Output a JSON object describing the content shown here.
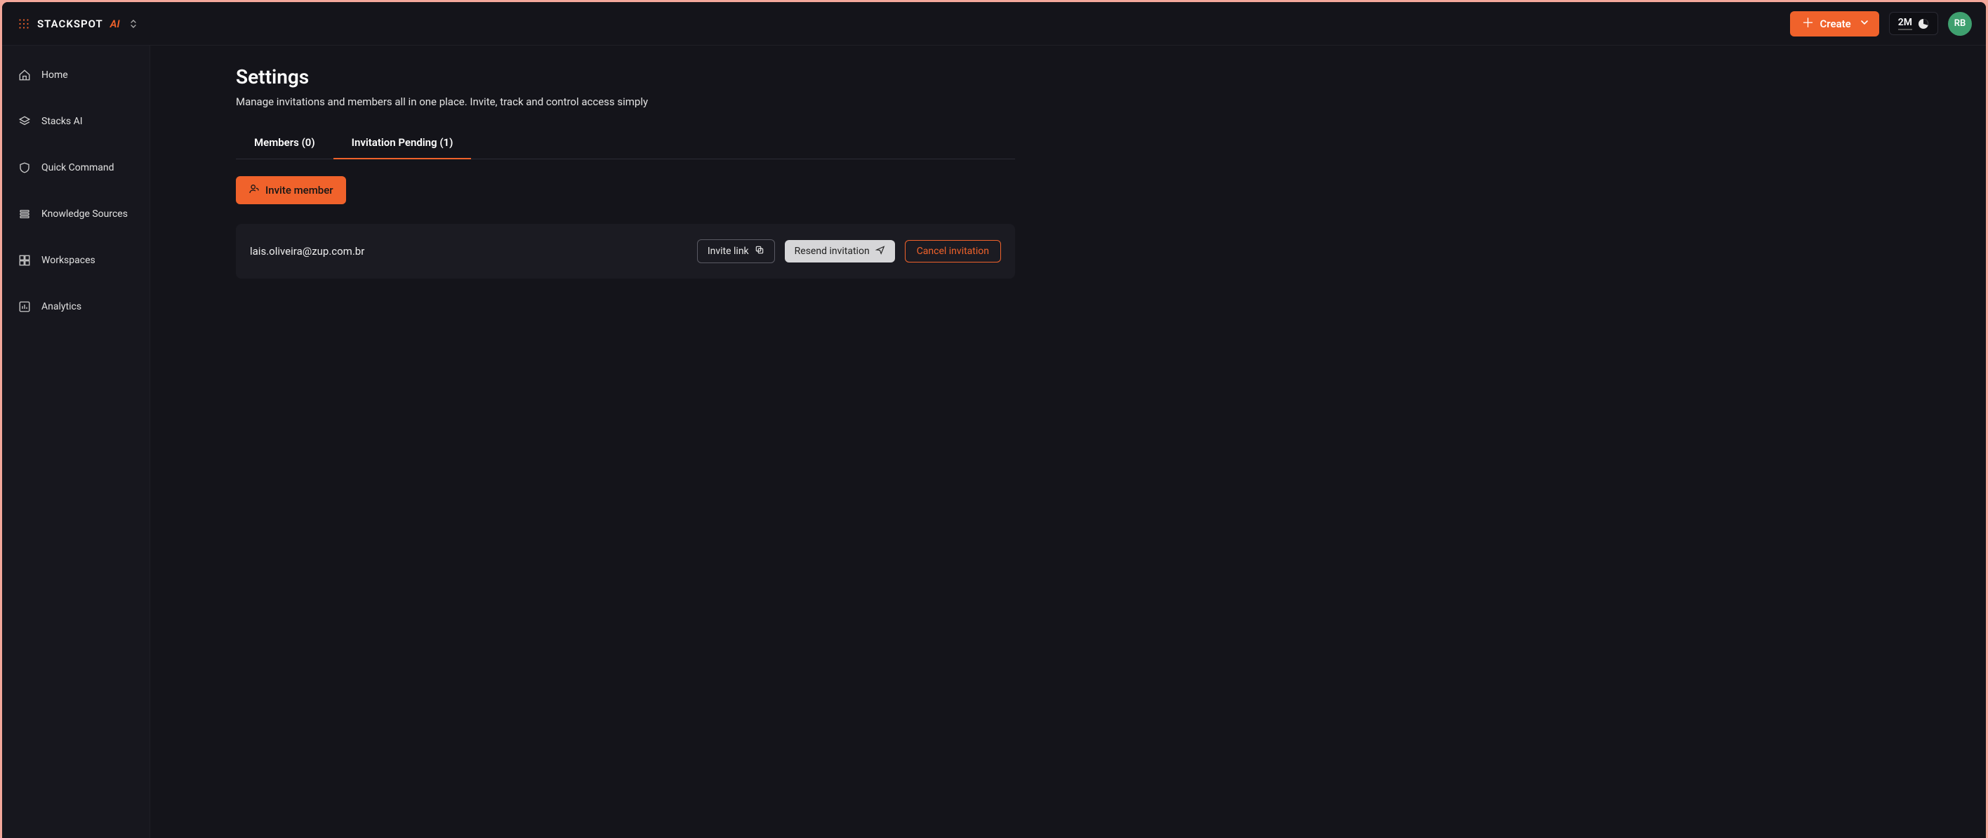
{
  "brand": {
    "name": "STACKSPOT",
    "suffix": "AI"
  },
  "header": {
    "create_label": "Create",
    "token_count": "2M",
    "avatar_initials": "RB"
  },
  "sidebar": {
    "items": [
      {
        "label": "Home"
      },
      {
        "label": "Stacks AI"
      },
      {
        "label": "Quick Command"
      },
      {
        "label": "Knowledge Sources"
      },
      {
        "label": "Workspaces"
      },
      {
        "label": "Analytics"
      }
    ]
  },
  "page": {
    "title": "Settings",
    "subtitle": "Manage invitations and members all in one place. Invite, track and control access simply"
  },
  "tabs": {
    "members": "Members (0)",
    "pending": "Invitation Pending (1)"
  },
  "actions": {
    "invite_member": "Invite member"
  },
  "invitations": [
    {
      "email": "lais.oliveira@zup.com.br",
      "invite_link_label": "Invite link",
      "resend_label": "Resend invitation",
      "cancel_label": "Cancel invitation"
    }
  ]
}
